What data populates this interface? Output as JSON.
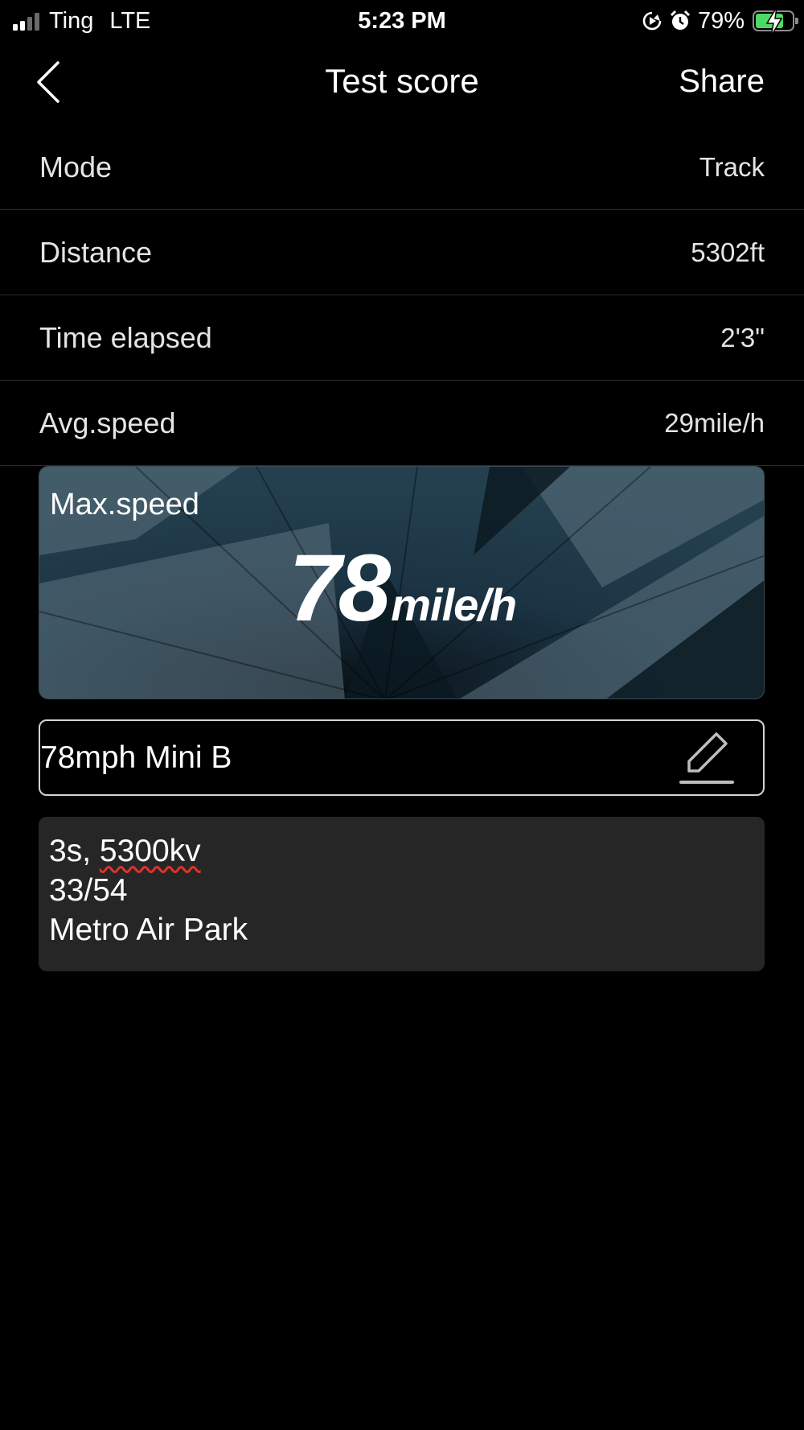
{
  "status_bar": {
    "carrier": "Ting",
    "network": "LTE",
    "time": "5:23 PM",
    "battery_percent": "79%",
    "battery_level": 0.79,
    "icons": [
      "signal-icon",
      "screen-rotation-lock-icon",
      "alarm-icon",
      "battery-charging-icon"
    ]
  },
  "nav": {
    "title": "Test score",
    "share_label": "Share",
    "back_icon": "chevron-left-icon"
  },
  "rows": [
    {
      "label": "Mode",
      "value": "Track"
    },
    {
      "label": "Distance",
      "value": "5302ft"
    },
    {
      "label": "Time elapsed",
      "value": "2'3\""
    },
    {
      "label": "Avg.speed",
      "value": "29mile/h"
    }
  ],
  "max_speed": {
    "label": "Max.speed",
    "value": "78",
    "unit": "mile/h"
  },
  "name_field": {
    "value": "78mph Mini B",
    "edit_icon": "pencil-edit-icon"
  },
  "notes": {
    "line1_prefix": "3s, ",
    "line1_misspelled": "5300kv",
    "line2": "33/54",
    "line3": "Metro Air Park"
  },
  "colors": {
    "background": "#000000",
    "row_divider": "#2a2a2a",
    "notes_bg": "#262626",
    "battery_fill": "#4cd964",
    "spellcheck_underline": "#e0322b"
  }
}
